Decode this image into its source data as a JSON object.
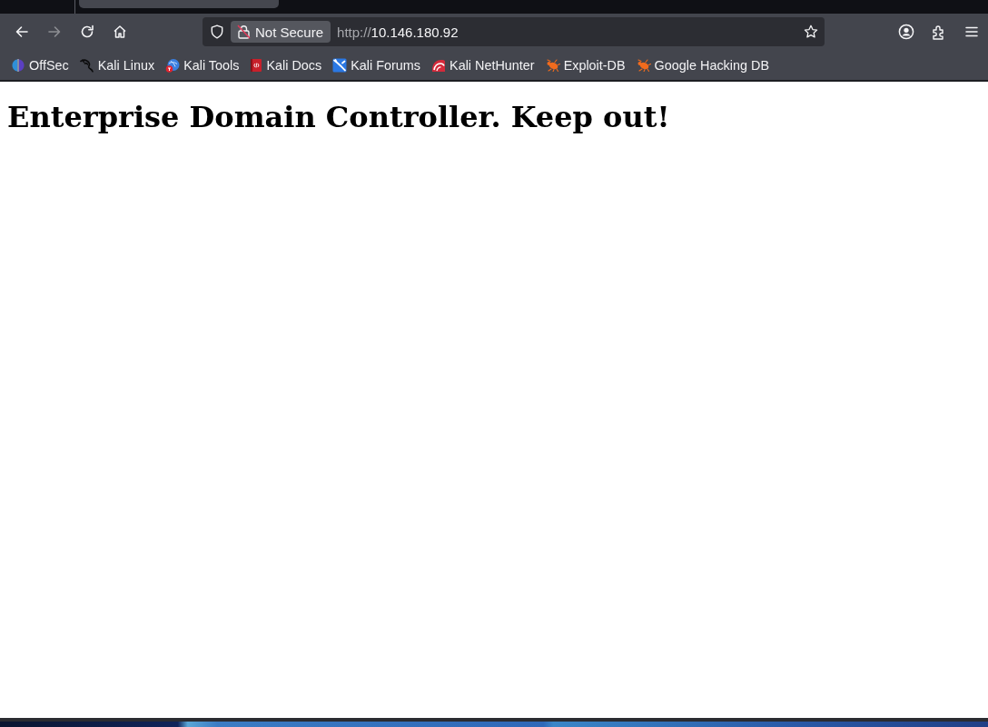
{
  "nav_buttons": [
    {
      "kind": "back",
      "disabled": false
    },
    {
      "kind": "forward",
      "disabled": true
    },
    {
      "kind": "reload",
      "disabled": false
    },
    {
      "kind": "home",
      "disabled": false
    }
  ],
  "address_bar": {
    "security_label": "Not Secure",
    "url": {
      "scheme": "http://",
      "host": "10.146.180.92"
    }
  },
  "bookmarks": [
    {
      "kind": "offsec",
      "label": "OffSec"
    },
    {
      "kind": "kali-dragon",
      "label": "Kali Linux"
    },
    {
      "kind": "kali-tools",
      "label": "Kali Tools"
    },
    {
      "kind": "kali-docs",
      "label": "Kali Docs"
    },
    {
      "kind": "kali-forums",
      "label": "Kali Forums"
    },
    {
      "kind": "nethunter",
      "label": "Kali NetHunter"
    },
    {
      "kind": "bug",
      "label": "Exploit-DB"
    },
    {
      "kind": "bug",
      "label": "Google Hacking DB"
    }
  ],
  "page": {
    "heading": "Enterprise Domain Controller. Keep out!"
  }
}
